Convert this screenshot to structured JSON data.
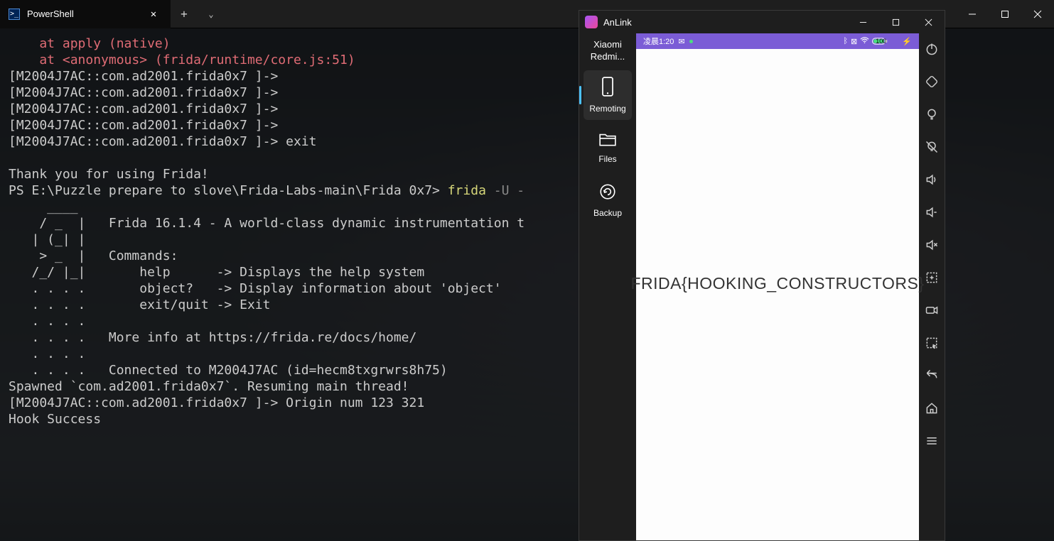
{
  "terminal": {
    "tab_title": "PowerShell",
    "line_err1": "    at apply (native)",
    "line_err2": "    at <anonymous> (frida/runtime/core.js:51)",
    "prompt": "[M2004J7AC::com.ad2001.frida0x7 ]->",
    "prompt_exit": "[M2004J7AC::com.ad2001.frida0x7 ]-> exit",
    "blank": "",
    "thanks": "Thank you for using Frida!",
    "ps_prompt": "PS E:\\Puzzle prepare to slove\\Frida-Labs-main\\Frida 0x7> ",
    "ps_cmd": "frida",
    "ps_flag": " -U -",
    "banner1": "     ____",
    "banner2": "    / _  |   Frida 16.1.4 - A world-class dynamic instrumentation t",
    "banner3": "   | (_| |",
    "banner4": "    > _  |   Commands:",
    "banner5": "   /_/ |_|       help      -> Displays the help system",
    "banner6": "   . . . .       object?   -> Display information about 'object'",
    "banner7": "   . . . .       exit/quit -> Exit",
    "banner8": "   . . . .",
    "banner9": "   . . . .   More info at https://frida.re/docs/home/",
    "banner10": "   . . . .",
    "banner11": "   . . . .   Connected to M2004J7AC (id=hecm8txgrwrs8h75)",
    "spawned": "Spawned `com.ad2001.frida0x7`. Resuming main thread!",
    "origin": "[M2004J7AC::com.ad2001.frida0x7 ]-> Origin num 123 321",
    "hook": "Hook Success"
  },
  "anlink": {
    "title": "AnLink",
    "device_line1": "Xiaomi",
    "device_line2": "Redmi...",
    "sidebar": {
      "remoting": "Remoting",
      "files": "Files",
      "backup": "Backup"
    },
    "statusbar": {
      "time": "凌晨1:20",
      "battery": "100"
    },
    "flag": "FRIDA{HOOKING_CONSTRUCTORS}"
  }
}
